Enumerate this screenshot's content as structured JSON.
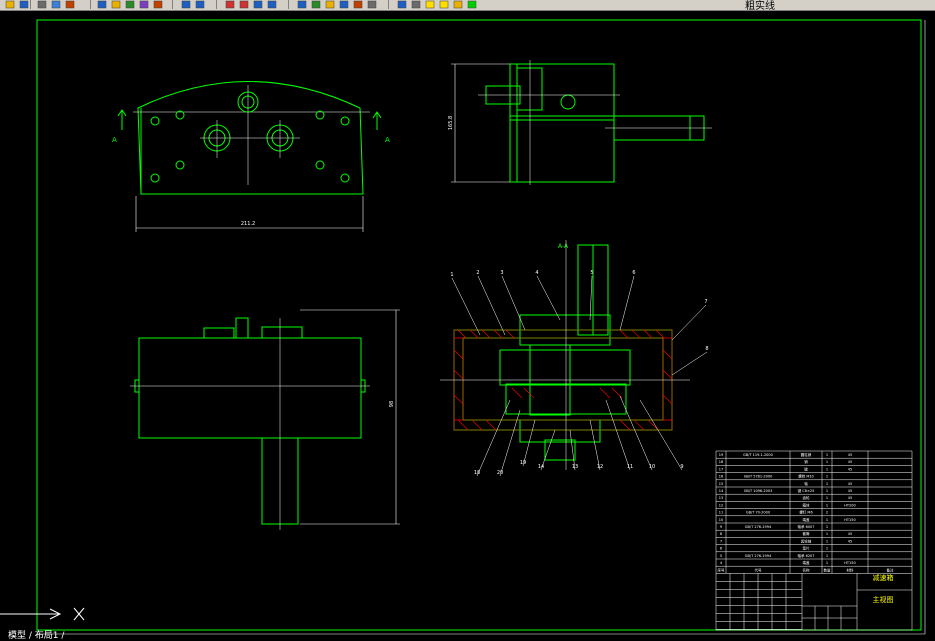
{
  "toolbar": {
    "layer_name": "粗实线",
    "buttons": [
      "open-icon",
      "save-icon",
      "print-icon",
      "preview-icon",
      "publish-icon",
      "cut-icon",
      "copy-icon",
      "paste-icon",
      "match-properties-icon",
      "block-editor-icon",
      "undo-icon",
      "redo-icon",
      "pan-icon",
      "zoom-realtime-icon",
      "zoom-window-icon",
      "zoom-previous-icon",
      "properties-icon",
      "design-center-icon",
      "tool-palettes-icon",
      "sheet-set-icon",
      "markup-icon",
      "calculator-icon",
      "help-icon",
      "layer-manager-icon",
      "light-bulb-icon",
      "sun-icon",
      "lock-icon",
      "color-swatch-icon"
    ]
  },
  "drawing": {
    "colors": {
      "background": "#000000",
      "geometry": "#00ff00",
      "centerline": "#ffffff",
      "dimension": "#ffffff",
      "hatch": "#ff0000",
      "table_text": "#ffff00"
    },
    "dim_width_top": "211.2",
    "dim_height_side": "165.8",
    "dim_height_front": "98",
    "section_label_left": "A",
    "section_label_right": "A",
    "section_title": "A-A",
    "balloon_numbers_top": [
      "1",
      "2",
      "3",
      "4",
      "5",
      "6",
      "7",
      "8"
    ],
    "balloon_numbers_bottom": [
      "18",
      "20",
      "19",
      "14",
      "13",
      "12",
      "11",
      "10",
      "9"
    ],
    "title_block": {
      "rows": [
        {
          "no": "19",
          "code": "GB/T 119.1-2000",
          "name": "圆柱销",
          "qty": "1",
          "mat": "45",
          "note": ""
        },
        {
          "no": "18",
          "code": "",
          "name": "销",
          "qty": "1",
          "mat": "45",
          "note": ""
        },
        {
          "no": "17",
          "code": "",
          "name": "键",
          "qty": "1",
          "mat": "45",
          "note": ""
        },
        {
          "no": "16",
          "code": "GB/T 5781-2000",
          "name": "螺栓 M10",
          "qty": "1",
          "mat": "",
          "note": ""
        },
        {
          "no": "15",
          "code": "",
          "name": "轴",
          "qty": "1",
          "mat": "45",
          "note": ""
        },
        {
          "no": "14",
          "code": "GB/T 1096-2003",
          "name": "键 C8×25",
          "qty": "1",
          "mat": "45",
          "note": ""
        },
        {
          "no": "13",
          "code": "",
          "name": "齿轮",
          "qty": "1",
          "mat": "45",
          "note": ""
        },
        {
          "no": "12",
          "code": "",
          "name": "箱体",
          "qty": "1",
          "mat": "HT200",
          "note": ""
        },
        {
          "no": "11",
          "code": "GB/T 70-2000",
          "name": "螺钉 M6",
          "qty": "2",
          "mat": "",
          "note": ""
        },
        {
          "no": "10",
          "code": "",
          "name": "端盖",
          "qty": "1",
          "mat": "HT150",
          "note": ""
        },
        {
          "no": "9",
          "code": "GB/T 276-1994",
          "name": "轴承 6007",
          "qty": "1",
          "mat": "",
          "note": ""
        },
        {
          "no": "8",
          "code": "",
          "name": "套筒",
          "qty": "1",
          "mat": "45",
          "note": ""
        },
        {
          "no": "7",
          "code": "",
          "name": "齿轮轴",
          "qty": "1",
          "mat": "45",
          "note": ""
        },
        {
          "no": "6",
          "code": "",
          "name": "垫片",
          "qty": "1",
          "mat": "",
          "note": ""
        },
        {
          "no": "5",
          "code": "GB/T 276-1994",
          "name": "轴承 6207",
          "qty": "1",
          "mat": "",
          "note": ""
        },
        {
          "no": "4",
          "code": "",
          "name": "端盖",
          "qty": "1",
          "mat": "HT150",
          "note": ""
        }
      ],
      "header": {
        "no": "序号",
        "code": "代号",
        "name": "名称",
        "qty": "数量",
        "mat": "材料",
        "note": "备注"
      },
      "drawing_title": "减速箱",
      "drawing_subtitle": "主视图"
    },
    "cmd_text": "模型 / 布局1 /"
  }
}
